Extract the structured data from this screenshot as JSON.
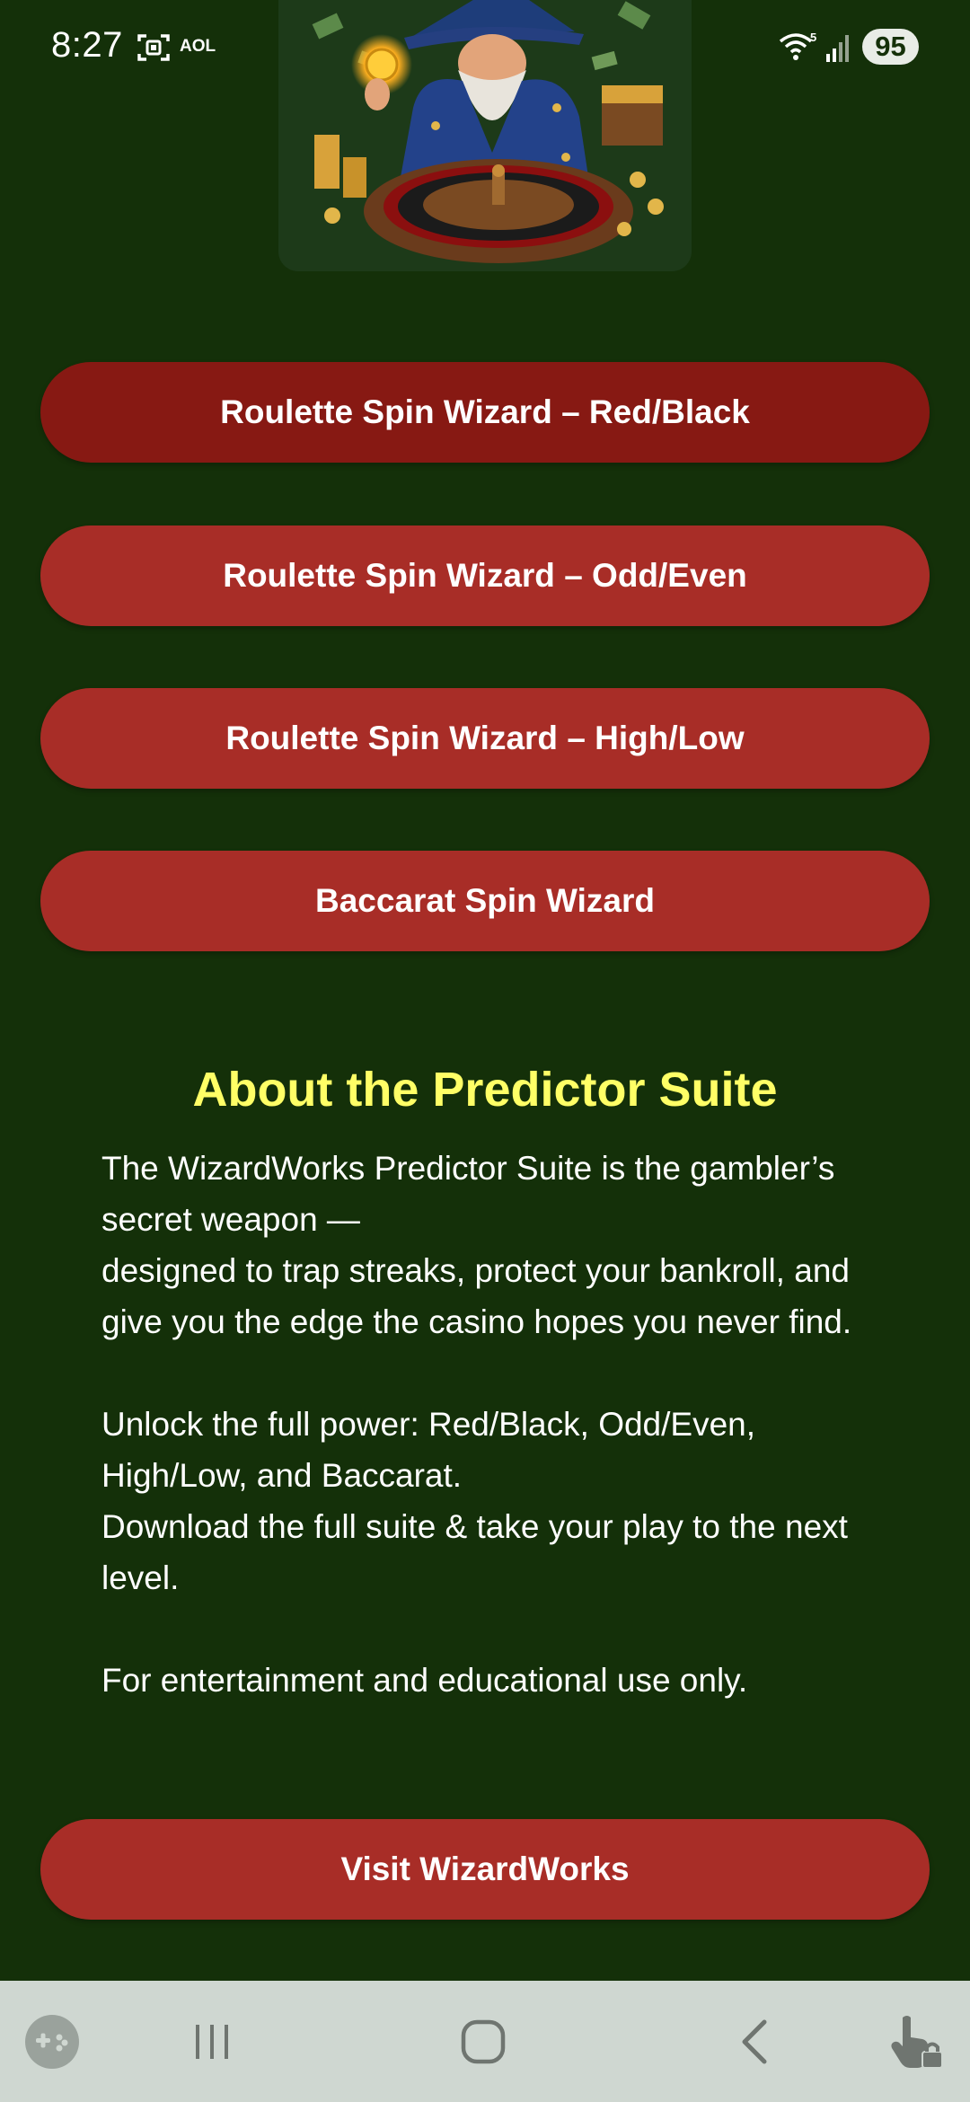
{
  "status_bar": {
    "time": "8:27",
    "carrier_badge": "AOL",
    "wifi_label": "5",
    "battery": "95"
  },
  "buttons": [
    {
      "label": "Roulette Spin Wizard – Red/Black"
    },
    {
      "label": "Roulette Spin Wizard – Odd/Even"
    },
    {
      "label": "Roulette Spin Wizard – High/Low"
    },
    {
      "label": "Baccarat Spin Wizard"
    }
  ],
  "about": {
    "title": "About the Predictor Suite",
    "lines": [
      "The WizardWorks Predictor Suite is the gambler’s secret weapon —",
      "designed to trap streaks, protect your bankroll, and give you the edge the casino hopes you never find.",
      "Unlock the full power: Red/Black, Odd/Even, High/Low, and Baccarat.",
      "Download the full suite & take your play to the next level.",
      "For entertainment and educational use only."
    ]
  },
  "visit_button": {
    "label": "Visit WizardWorks"
  },
  "nav_bar": {
    "items": [
      "game-launcher-icon",
      "recent-apps-icon",
      "home-icon",
      "back-icon",
      "touch-lock-icon"
    ]
  },
  "colors": {
    "background": "#143009",
    "button": "#a82d27",
    "button_active": "#871913",
    "title": "#ffff66",
    "nav_bar": "#cfd7d1"
  }
}
